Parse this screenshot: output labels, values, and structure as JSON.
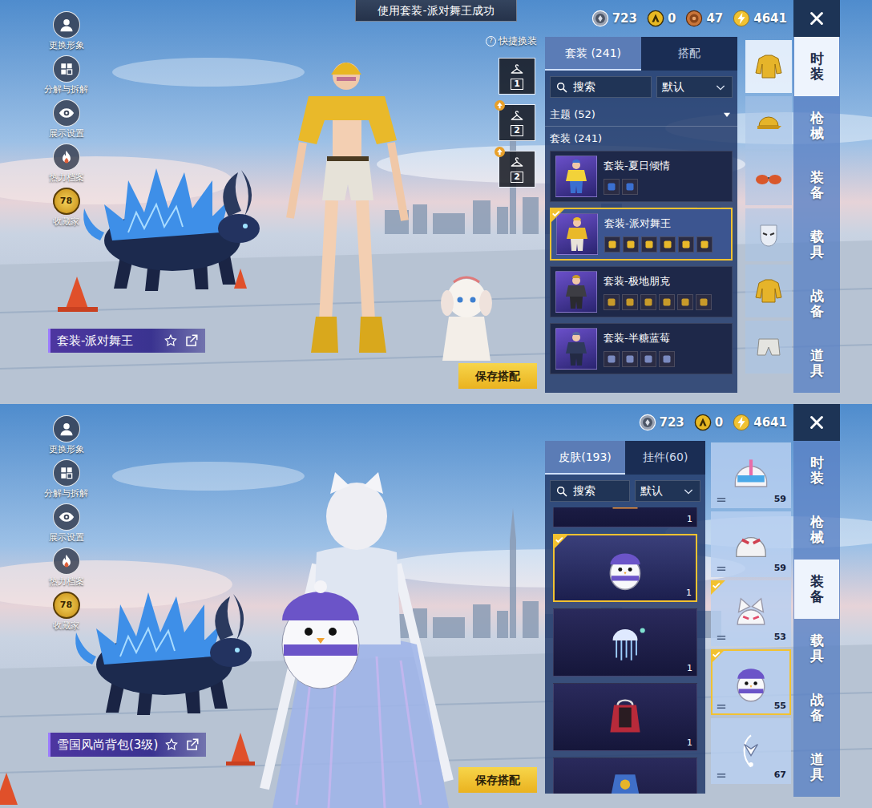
{
  "screens": [
    {
      "kind": "outfit",
      "banner": "使用套装-派对舞王成功",
      "currencies": [
        {
          "kind": "silver",
          "value": "723"
        },
        {
          "kind": "gold",
          "value": "0"
        },
        {
          "kind": "bronze",
          "value": "47"
        },
        {
          "kind": "uc",
          "value": "4641"
        }
      ],
      "side_menu": [
        {
          "kind": "avatar",
          "label": "更换形象"
        },
        {
          "kind": "decompose",
          "label": "分解与拆解"
        },
        {
          "kind": "display",
          "label": "展示设置"
        },
        {
          "kind": "heat",
          "label": "热力档案"
        },
        {
          "kind": "collector",
          "label": "收藏家",
          "badge": "78"
        }
      ],
      "title": "套装-派对舞王",
      "quick_change": {
        "help": "?",
        "label": "快捷换装",
        "slots": [
          {
            "number": "1",
            "upgrade": false
          },
          {
            "number": "2",
            "upgrade": true
          },
          {
            "number": "2",
            "upgrade": true
          }
        ]
      },
      "list_tabs": [
        {
          "label": "套装 (241)",
          "selected": true
        },
        {
          "label": "搭配",
          "selected": false
        }
      ],
      "search": "搜索",
      "sort": "默认",
      "theme": "主题 (52)",
      "section": "套装 (241)",
      "items": [
        {
          "kind": "summer",
          "name": "套装-夏日倾情",
          "parts": 2,
          "selected": false
        },
        {
          "kind": "party",
          "name": "套装-派对舞王",
          "parts": 6,
          "selected": true
        },
        {
          "kind": "punk",
          "name": "套装-极地朋克",
          "parts": 6,
          "selected": false
        },
        {
          "kind": "berry",
          "name": "套装-半糖蓝莓",
          "parts": 4,
          "selected": false
        }
      ],
      "categories": [
        {
          "kind": "jacket",
          "selected": true
        },
        {
          "kind": "cap",
          "selected": false
        },
        {
          "kind": "glasses",
          "selected": false
        },
        {
          "kind": "mask",
          "selected": false
        },
        {
          "kind": "jacket",
          "selected": false
        },
        {
          "kind": "shorts",
          "selected": false
        }
      ],
      "save": "保存搭配",
      "nav": [
        {
          "label": "时装",
          "selected": true
        },
        {
          "label": "枪械",
          "selected": false
        },
        {
          "label": "装备",
          "selected": false
        },
        {
          "label": "载具",
          "selected": false
        },
        {
          "label": "战备",
          "selected": false
        },
        {
          "label": "道具",
          "selected": false
        }
      ]
    },
    {
      "kind": "equipment",
      "currencies": [
        {
          "kind": "silver",
          "value": "723"
        },
        {
          "kind": "gold",
          "value": "0"
        },
        {
          "kind": "uc",
          "value": "4641"
        }
      ],
      "side_menu": [
        {
          "kind": "avatar",
          "label": "更换形象"
        },
        {
          "kind": "decompose",
          "label": "分解与拆解"
        },
        {
          "kind": "display",
          "label": "展示设置"
        },
        {
          "kind": "heat",
          "label": "热力档案"
        },
        {
          "kind": "collector",
          "label": "收藏家",
          "badge": "78"
        }
      ],
      "title": "雪国风尚背包(3级)",
      "list_tabs": [
        {
          "label": "皮肤(193)",
          "selected": true
        },
        {
          "label": "挂件(60)",
          "selected": false
        }
      ],
      "search": "搜索",
      "sort": "默认",
      "cards": [
        {
          "kind": "orange",
          "count": "1",
          "selected": false
        },
        {
          "kind": "penguin",
          "count": "1",
          "selected": true
        },
        {
          "kind": "jellyfish",
          "count": "1",
          "selected": false
        },
        {
          "kind": "red",
          "count": "1",
          "selected": false
        },
        {
          "kind": "blue",
          "selected": false
        }
      ],
      "slots": [
        {
          "kind": "helmet-pink",
          "number": "59",
          "equipped": false,
          "selected": false
        },
        {
          "kind": "helmet-white",
          "number": "59",
          "equipped": false,
          "selected": false
        },
        {
          "kind": "helmet-cat",
          "number": "53",
          "equipped": true,
          "selected": false
        },
        {
          "kind": "penguin",
          "number": "55",
          "equipped": true,
          "selected": true
        },
        {
          "kind": "ornament",
          "number": "67",
          "equipped": false,
          "selected": false
        }
      ],
      "save": "保存搭配",
      "nav": [
        {
          "label": "时装",
          "selected": false
        },
        {
          "label": "枪械",
          "selected": false
        },
        {
          "label": "装备",
          "selected": true
        },
        {
          "label": "载具",
          "selected": false
        },
        {
          "label": "战备",
          "selected": false
        },
        {
          "label": "道具",
          "selected": false
        }
      ]
    }
  ]
}
